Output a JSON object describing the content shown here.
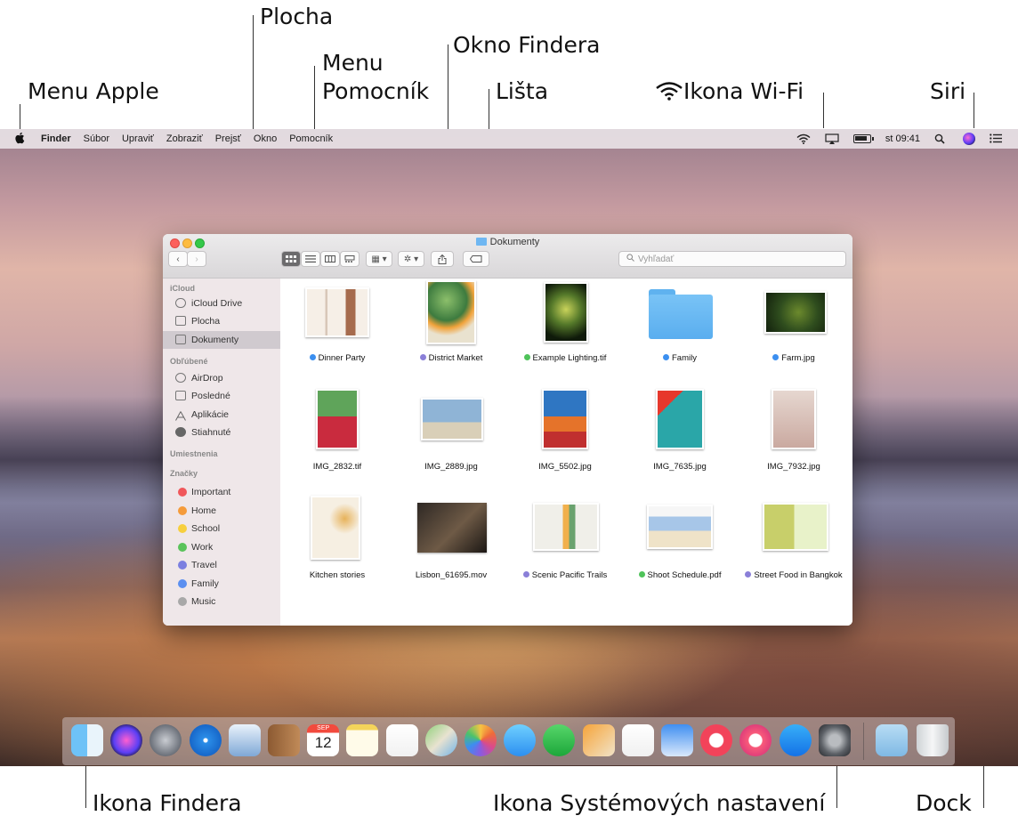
{
  "callouts": {
    "menu_apple": "Menu Apple",
    "plocha": "Plocha",
    "menu_pomocnik_1": "Menu",
    "menu_pomocnik_2": "Pomocník",
    "okno_findera": "Okno Findera",
    "lista": "Lišta",
    "wifi": "Ikona Wi-Fi",
    "siri": "Siri",
    "ikona_findera": "Ikona Findera",
    "ikona_nastaveni": "Ikona Systémových nastavení",
    "dock": "Dock"
  },
  "menubar": {
    "app": "Finder",
    "items": [
      "Súbor",
      "Upraviť",
      "Zobraziť",
      "Prejsť",
      "Okno",
      "Pomocník"
    ],
    "clock": "st 09:41"
  },
  "window": {
    "title": "Dokumenty",
    "search_placeholder": "Vyhľadať"
  },
  "sidebar": {
    "icloud_head": "iCloud",
    "icloud": [
      "iCloud Drive",
      "Plocha",
      "Dokumenty"
    ],
    "favorites_head": "Obľúbené",
    "favorites": [
      "AirDrop",
      "Posledné",
      "Aplikácie",
      "Stiahnuté"
    ],
    "locations_head": "Umiestnenia",
    "tags_head": "Značky",
    "tags": [
      {
        "label": "Important",
        "color": "#f0575a"
      },
      {
        "label": "Home",
        "color": "#f59b3a"
      },
      {
        "label": "School",
        "color": "#f7cf3d"
      },
      {
        "label": "Work",
        "color": "#5ac35a"
      },
      {
        "label": "Travel",
        "color": "#7b7fe0"
      },
      {
        "label": "Family",
        "color": "#5b8ff0"
      },
      {
        "label": "Music",
        "color": "#a8a8a8"
      }
    ]
  },
  "files": [
    {
      "name": "Dinner Party",
      "tag": "#3b8ff0"
    },
    {
      "name": "District Market",
      "tag": "#8a7fd8"
    },
    {
      "name": "Example Lighting.tif",
      "tag": "#4fc35a"
    },
    {
      "name": "Family",
      "tag": "#3b8ff0"
    },
    {
      "name": "Farm.jpg",
      "tag": "#3b8ff0"
    },
    {
      "name": "IMG_2832.tif",
      "tag": ""
    },
    {
      "name": "IMG_2889.jpg",
      "tag": ""
    },
    {
      "name": "IMG_5502.jpg",
      "tag": ""
    },
    {
      "name": "IMG_7635.jpg",
      "tag": ""
    },
    {
      "name": "IMG_7932.jpg",
      "tag": ""
    },
    {
      "name": "Kitchen stories",
      "tag": ""
    },
    {
      "name": "Lisbon_61695.mov",
      "tag": ""
    },
    {
      "name": "Scenic Pacific Trails",
      "tag": "#8a7fd8"
    },
    {
      "name": "Shoot Schedule.pdf",
      "tag": "#4fc35a"
    },
    {
      "name": "Street Food in Bangkok",
      "tag": "#8a7fd8"
    }
  ],
  "dock": {
    "apps": [
      "finder-icon",
      "siri-icon",
      "launchpad-icon",
      "safari-icon",
      "mail-icon",
      "contacts-icon",
      "calendar-icon",
      "notes-icon",
      "reminders-icon",
      "maps-icon",
      "photos-icon",
      "messages-icon",
      "facetime-icon",
      "pages-icon",
      "numbers-icon",
      "keynote-icon",
      "news-icon",
      "music-icon",
      "app-store-icon",
      "system-preferences-icon"
    ],
    "calendar_month": "SEP",
    "calendar_day": "12"
  }
}
